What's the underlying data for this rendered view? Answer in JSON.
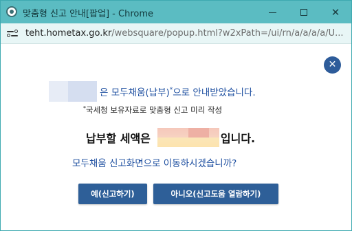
{
  "window": {
    "title": "맞춤형 신고 안내[팝업] - Chrome",
    "controls": {
      "minimize_icon": "minimize-icon",
      "maximize_icon": "maximize-icon",
      "close_icon": "close-icon"
    }
  },
  "addressbar": {
    "url_host": "teht.hometax.go.kr",
    "url_path": "/websquare/popup.html?w2xPath=/ui/rn/a/a/a/a/U..."
  },
  "dialog": {
    "close_symbol": "✕",
    "line1_text": "은 모두채움(납부)",
    "line1_sup": "*",
    "line1_tail": "으로 안내받았습니다.",
    "note_sup": "*",
    "note_text": "국세청 보유자료로 맞춤형 신고 미리 작성",
    "line3_pre": "납부할 세액은",
    "line3_post": "입니다.",
    "question": "모두채움 신고화면으로 이동하시겠습니까?",
    "yes_button": "예(신고하기)",
    "no_button": "아니오(신고도움 열람하기)"
  },
  "colors": {
    "titlebar": "#5bbcc2",
    "primary_text": "#1e4fa0",
    "button": "#2e5f98",
    "close_circle": "#2e5c9a"
  }
}
